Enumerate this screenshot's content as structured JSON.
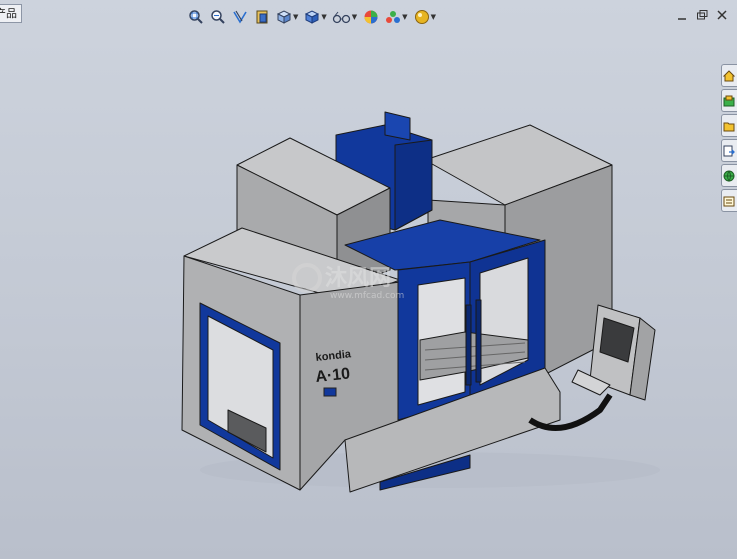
{
  "window": {
    "tab_label": "产品"
  },
  "heads_up_toolbar": {
    "tools": [
      {
        "name": "zoom-to-fit"
      },
      {
        "name": "zoom-to-area"
      },
      {
        "name": "previous-view"
      },
      {
        "name": "section-view"
      },
      {
        "name": "view-orientation",
        "dropdown": true
      },
      {
        "name": "display-style",
        "dropdown": true
      },
      {
        "name": "hide-show-items",
        "dropdown": true
      },
      {
        "name": "edit-appearance"
      },
      {
        "name": "apply-scene",
        "dropdown": true
      },
      {
        "name": "view-settings",
        "dropdown": true
      }
    ]
  },
  "window_controls": [
    "minimize",
    "restore",
    "close"
  ],
  "task_pane": {
    "tabs": [
      "resources-home",
      "design-library",
      "file-explorer",
      "view-palette",
      "appearances",
      "custom-properties"
    ]
  },
  "model": {
    "brand": "kondia",
    "model_name": "A·10"
  },
  "watermark": {
    "title": "沐风网",
    "url": "www.mfcad.com"
  },
  "colors": {
    "machine_gray": "#a8a9ab",
    "machine_blue": "#10379b",
    "viewport_bg": "#c6ccd7"
  }
}
